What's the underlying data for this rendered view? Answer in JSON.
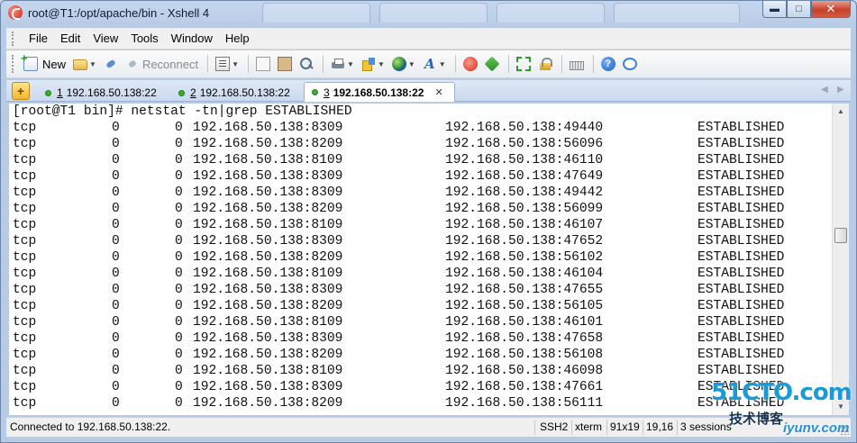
{
  "window": {
    "title": "root@T1:/opt/apache/bin - Xshell 4",
    "controls": {
      "minimize": "▬",
      "maximize": "□",
      "close": "✕"
    }
  },
  "menu": [
    "File",
    "Edit",
    "View",
    "Tools",
    "Window",
    "Help"
  ],
  "toolbar": {
    "new_label": "New",
    "reconnect_label": "Reconnect"
  },
  "tabs": [
    {
      "number": "1",
      "label": "192.168.50.138:22",
      "active": false
    },
    {
      "number": "2",
      "label": "192.168.50.138:22",
      "active": false
    },
    {
      "number": "3",
      "label": "192.168.50.138:22",
      "active": true
    }
  ],
  "terminal": {
    "prompt_line": "[root@T1 bin]# netstat -tn|grep ESTABLISHED",
    "rows": [
      {
        "proto": "tcp",
        "recv_q": "0",
        "send_q": "0",
        "local": "192.168.50.138:8309",
        "foreign": "192.168.50.138:49440",
        "state": "ESTABLISHED"
      },
      {
        "proto": "tcp",
        "recv_q": "0",
        "send_q": "0",
        "local": "192.168.50.138:8209",
        "foreign": "192.168.50.138:56096",
        "state": "ESTABLISHED"
      },
      {
        "proto": "tcp",
        "recv_q": "0",
        "send_q": "0",
        "local": "192.168.50.138:8109",
        "foreign": "192.168.50.138:46110",
        "state": "ESTABLISHED"
      },
      {
        "proto": "tcp",
        "recv_q": "0",
        "send_q": "0",
        "local": "192.168.50.138:8309",
        "foreign": "192.168.50.138:47649",
        "state": "ESTABLISHED"
      },
      {
        "proto": "tcp",
        "recv_q": "0",
        "send_q": "0",
        "local": "192.168.50.138:8309",
        "foreign": "192.168.50.138:49442",
        "state": "ESTABLISHED"
      },
      {
        "proto": "tcp",
        "recv_q": "0",
        "send_q": "0",
        "local": "192.168.50.138:8209",
        "foreign": "192.168.50.138:56099",
        "state": "ESTABLISHED"
      },
      {
        "proto": "tcp",
        "recv_q": "0",
        "send_q": "0",
        "local": "192.168.50.138:8109",
        "foreign": "192.168.50.138:46107",
        "state": "ESTABLISHED"
      },
      {
        "proto": "tcp",
        "recv_q": "0",
        "send_q": "0",
        "local": "192.168.50.138:8309",
        "foreign": "192.168.50.138:47652",
        "state": "ESTABLISHED"
      },
      {
        "proto": "tcp",
        "recv_q": "0",
        "send_q": "0",
        "local": "192.168.50.138:8209",
        "foreign": "192.168.50.138:56102",
        "state": "ESTABLISHED"
      },
      {
        "proto": "tcp",
        "recv_q": "0",
        "send_q": "0",
        "local": "192.168.50.138:8109",
        "foreign": "192.168.50.138:46104",
        "state": "ESTABLISHED"
      },
      {
        "proto": "tcp",
        "recv_q": "0",
        "send_q": "0",
        "local": "192.168.50.138:8309",
        "foreign": "192.168.50.138:47655",
        "state": "ESTABLISHED"
      },
      {
        "proto": "tcp",
        "recv_q": "0",
        "send_q": "0",
        "local": "192.168.50.138:8209",
        "foreign": "192.168.50.138:56105",
        "state": "ESTABLISHED"
      },
      {
        "proto": "tcp",
        "recv_q": "0",
        "send_q": "0",
        "local": "192.168.50.138:8109",
        "foreign": "192.168.50.138:46101",
        "state": "ESTABLISHED"
      },
      {
        "proto": "tcp",
        "recv_q": "0",
        "send_q": "0",
        "local": "192.168.50.138:8309",
        "foreign": "192.168.50.138:47658",
        "state": "ESTABLISHED"
      },
      {
        "proto": "tcp",
        "recv_q": "0",
        "send_q": "0",
        "local": "192.168.50.138:8209",
        "foreign": "192.168.50.138:56108",
        "state": "ESTABLISHED"
      },
      {
        "proto": "tcp",
        "recv_q": "0",
        "send_q": "0",
        "local": "192.168.50.138:8109",
        "foreign": "192.168.50.138:46098",
        "state": "ESTABLISHED"
      },
      {
        "proto": "tcp",
        "recv_q": "0",
        "send_q": "0",
        "local": "192.168.50.138:8309",
        "foreign": "192.168.50.138:47661",
        "state": "ESTABLISHED"
      },
      {
        "proto": "tcp",
        "recv_q": "0",
        "send_q": "0",
        "local": "192.168.50.138:8209",
        "foreign": "192.168.50.138:56111",
        "state": "ESTABLISHED"
      }
    ]
  },
  "status": {
    "connection": "Connected to 192.168.50.138:22.",
    "protocol": "SSH2",
    "terminal_type": "xterm",
    "size": "91x19",
    "cursor": "19,16",
    "sessions": "3 sessions"
  },
  "watermark": {
    "logo": "51CTO.com",
    "subtitle": "技术博客",
    "site": "iyunv.com"
  },
  "colors": {
    "window_frame": "#b8cbe6",
    "terminal_bg": "#ffffff",
    "terminal_fg": "#111111",
    "tab_active_dot": "#35b035",
    "close_button": "#c6402a"
  },
  "icons": [
    "app-logo-icon",
    "new-session-icon",
    "open-folder-icon",
    "connect-icon",
    "reconnect-icon",
    "properties-icon",
    "copy-icon",
    "paste-icon",
    "find-icon",
    "print-icon",
    "transfer-icon",
    "globe-icon",
    "font-icon",
    "xftp-icon",
    "xftp-alt-icon",
    "fullscreen-icon",
    "lock-icon",
    "keyboard-icon",
    "help-icon",
    "chat-icon"
  ]
}
